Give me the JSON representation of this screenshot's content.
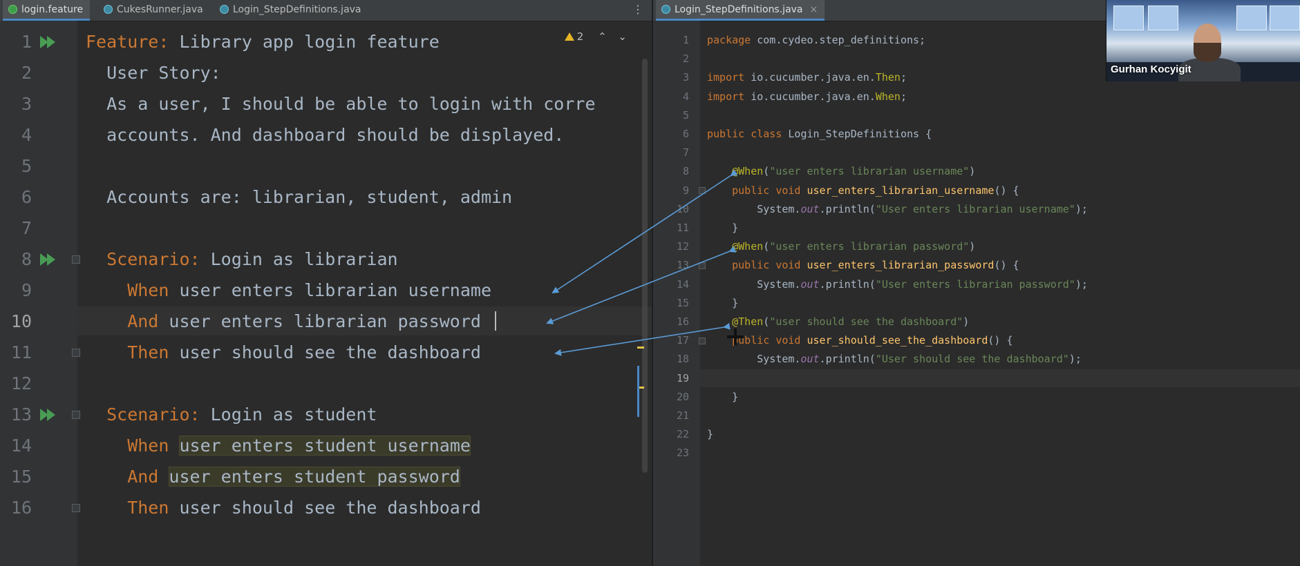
{
  "left_tabs": [
    {
      "label": "login.feature",
      "icon": "cucumber-file-icon"
    },
    {
      "label": "CukesRunner.java",
      "icon": "java-class-icon"
    },
    {
      "label": "Login_StepDefinitions.java",
      "icon": "java-class-icon"
    }
  ],
  "right_tabs": [
    {
      "label": "Login_StepDefinitions.java",
      "icon": "java-class-icon"
    }
  ],
  "inspection": {
    "warning_count": "2"
  },
  "feature_lines": [
    {
      "n": "1",
      "kw": "Feature:",
      "text": " Library app login feature",
      "hl": ""
    },
    {
      "n": "2",
      "kw": "",
      "text": "  User Story:",
      "hl": ""
    },
    {
      "n": "3",
      "kw": "",
      "text": "  As a user, I should be able to login with corre",
      "hl": ""
    },
    {
      "n": "4",
      "kw": "",
      "text": "  accounts. And dashboard should be displayed.",
      "hl": ""
    },
    {
      "n": "5",
      "kw": "",
      "text": "",
      "hl": ""
    },
    {
      "n": "6",
      "kw": "",
      "text": "  Accounts are: librarian, student, admin",
      "hl": ""
    },
    {
      "n": "7",
      "kw": "",
      "text": "",
      "hl": ""
    },
    {
      "n": "8",
      "kw": "  Scenario:",
      "text": " Login as librarian",
      "hl": ""
    },
    {
      "n": "9",
      "kw": "    When",
      "text": " user enters librarian username",
      "hl": ""
    },
    {
      "n": "10",
      "kw": "    And",
      "text": " user enters librarian password",
      "hl": ""
    },
    {
      "n": "11",
      "kw": "    Then",
      "text": " user should see the dashboard",
      "hl": ""
    },
    {
      "n": "12",
      "kw": "",
      "text": "",
      "hl": ""
    },
    {
      "n": "13",
      "kw": "  Scenario:",
      "text": " Login as student",
      "hl": ""
    },
    {
      "n": "14",
      "kw": "    When",
      "text": " ",
      "hl": "user enters student username"
    },
    {
      "n": "15",
      "kw": "    And",
      "text": " ",
      "hl": "user enters student password"
    },
    {
      "n": "16",
      "kw": "    Then",
      "text": " user should see the dashboard",
      "hl": ""
    }
  ],
  "java_lines": [
    {
      "n": "1",
      "segs": [
        [
          "kw",
          "package "
        ],
        [
          "",
          "com.cydeo.step_definitions;"
        ]
      ]
    },
    {
      "n": "2",
      "segs": []
    },
    {
      "n": "3",
      "segs": [
        [
          "kw",
          "import "
        ],
        [
          "",
          "io.cucumber.java.en."
        ],
        [
          "ann",
          "Then"
        ],
        [
          "",
          ";"
        ]
      ]
    },
    {
      "n": "4",
      "segs": [
        [
          "kw",
          "import "
        ],
        [
          "",
          "io.cucumber.java.en."
        ],
        [
          "ann",
          "When"
        ],
        [
          "",
          ";"
        ]
      ]
    },
    {
      "n": "5",
      "segs": []
    },
    {
      "n": "6",
      "segs": [
        [
          "kw",
          "public class "
        ],
        [
          "",
          "Login_StepDefinitions {"
        ]
      ]
    },
    {
      "n": "7",
      "segs": []
    },
    {
      "n": "8",
      "segs": [
        [
          "",
          "    "
        ],
        [
          "ann",
          "@When"
        ],
        [
          "",
          "("
        ],
        [
          "str",
          "\"user enters librarian username\""
        ],
        [
          "",
          ")"
        ]
      ]
    },
    {
      "n": "9",
      "segs": [
        [
          "",
          "    "
        ],
        [
          "kw",
          "public void "
        ],
        [
          "fn",
          "user_enters_librarian_username"
        ],
        [
          "",
          "() {"
        ]
      ]
    },
    {
      "n": "10",
      "segs": [
        [
          "",
          "        System."
        ],
        [
          "stat",
          "out"
        ],
        [
          "",
          ".println("
        ],
        [
          "str",
          "\"User enters librarian username\""
        ],
        [
          "",
          ");"
        ]
      ]
    },
    {
      "n": "11",
      "segs": [
        [
          "",
          "    }"
        ]
      ]
    },
    {
      "n": "12",
      "segs": [
        [
          "",
          "    "
        ],
        [
          "ann",
          "@When"
        ],
        [
          "",
          "("
        ],
        [
          "str",
          "\"user enters librarian password\""
        ],
        [
          "",
          ")"
        ]
      ]
    },
    {
      "n": "13",
      "segs": [
        [
          "",
          "    "
        ],
        [
          "kw",
          "public void "
        ],
        [
          "fn",
          "user_enters_librarian_password"
        ],
        [
          "",
          "() {"
        ]
      ]
    },
    {
      "n": "14",
      "segs": [
        [
          "",
          "        System."
        ],
        [
          "stat",
          "out"
        ],
        [
          "",
          ".println("
        ],
        [
          "str",
          "\"User enters librarian password\""
        ],
        [
          "",
          ");"
        ]
      ]
    },
    {
      "n": "15",
      "segs": [
        [
          "",
          "    }"
        ]
      ]
    },
    {
      "n": "16",
      "segs": [
        [
          "",
          "    "
        ],
        [
          "ann",
          "@Then"
        ],
        [
          "",
          "("
        ],
        [
          "str",
          "\"user should see the dashboard\""
        ],
        [
          "",
          ")"
        ]
      ]
    },
    {
      "n": "17",
      "segs": [
        [
          "",
          "    "
        ],
        [
          "kw",
          "public void "
        ],
        [
          "fn",
          "user_should_see_the_dashboard"
        ],
        [
          "",
          "() {"
        ]
      ]
    },
    {
      "n": "18",
      "segs": [
        [
          "",
          "        System."
        ],
        [
          "stat",
          "out"
        ],
        [
          "",
          ".println("
        ],
        [
          "str",
          "\"User should see the dashboard\""
        ],
        [
          "",
          ");"
        ]
      ]
    },
    {
      "n": "19",
      "segs": []
    },
    {
      "n": "20",
      "segs": [
        [
          "",
          "    }"
        ]
      ]
    },
    {
      "n": "21",
      "segs": []
    },
    {
      "n": "22",
      "segs": [
        [
          "",
          "}"
        ]
      ]
    },
    {
      "n": "23",
      "segs": []
    }
  ],
  "video": {
    "participant_name": "Gurhan Kocyigit"
  },
  "colors": {
    "keyword": "#cc7832",
    "annotation": "#bbb529",
    "string": "#6a8759",
    "method": "#ffc66d",
    "arrow": "#5b9bd5",
    "run": "#499c54"
  }
}
